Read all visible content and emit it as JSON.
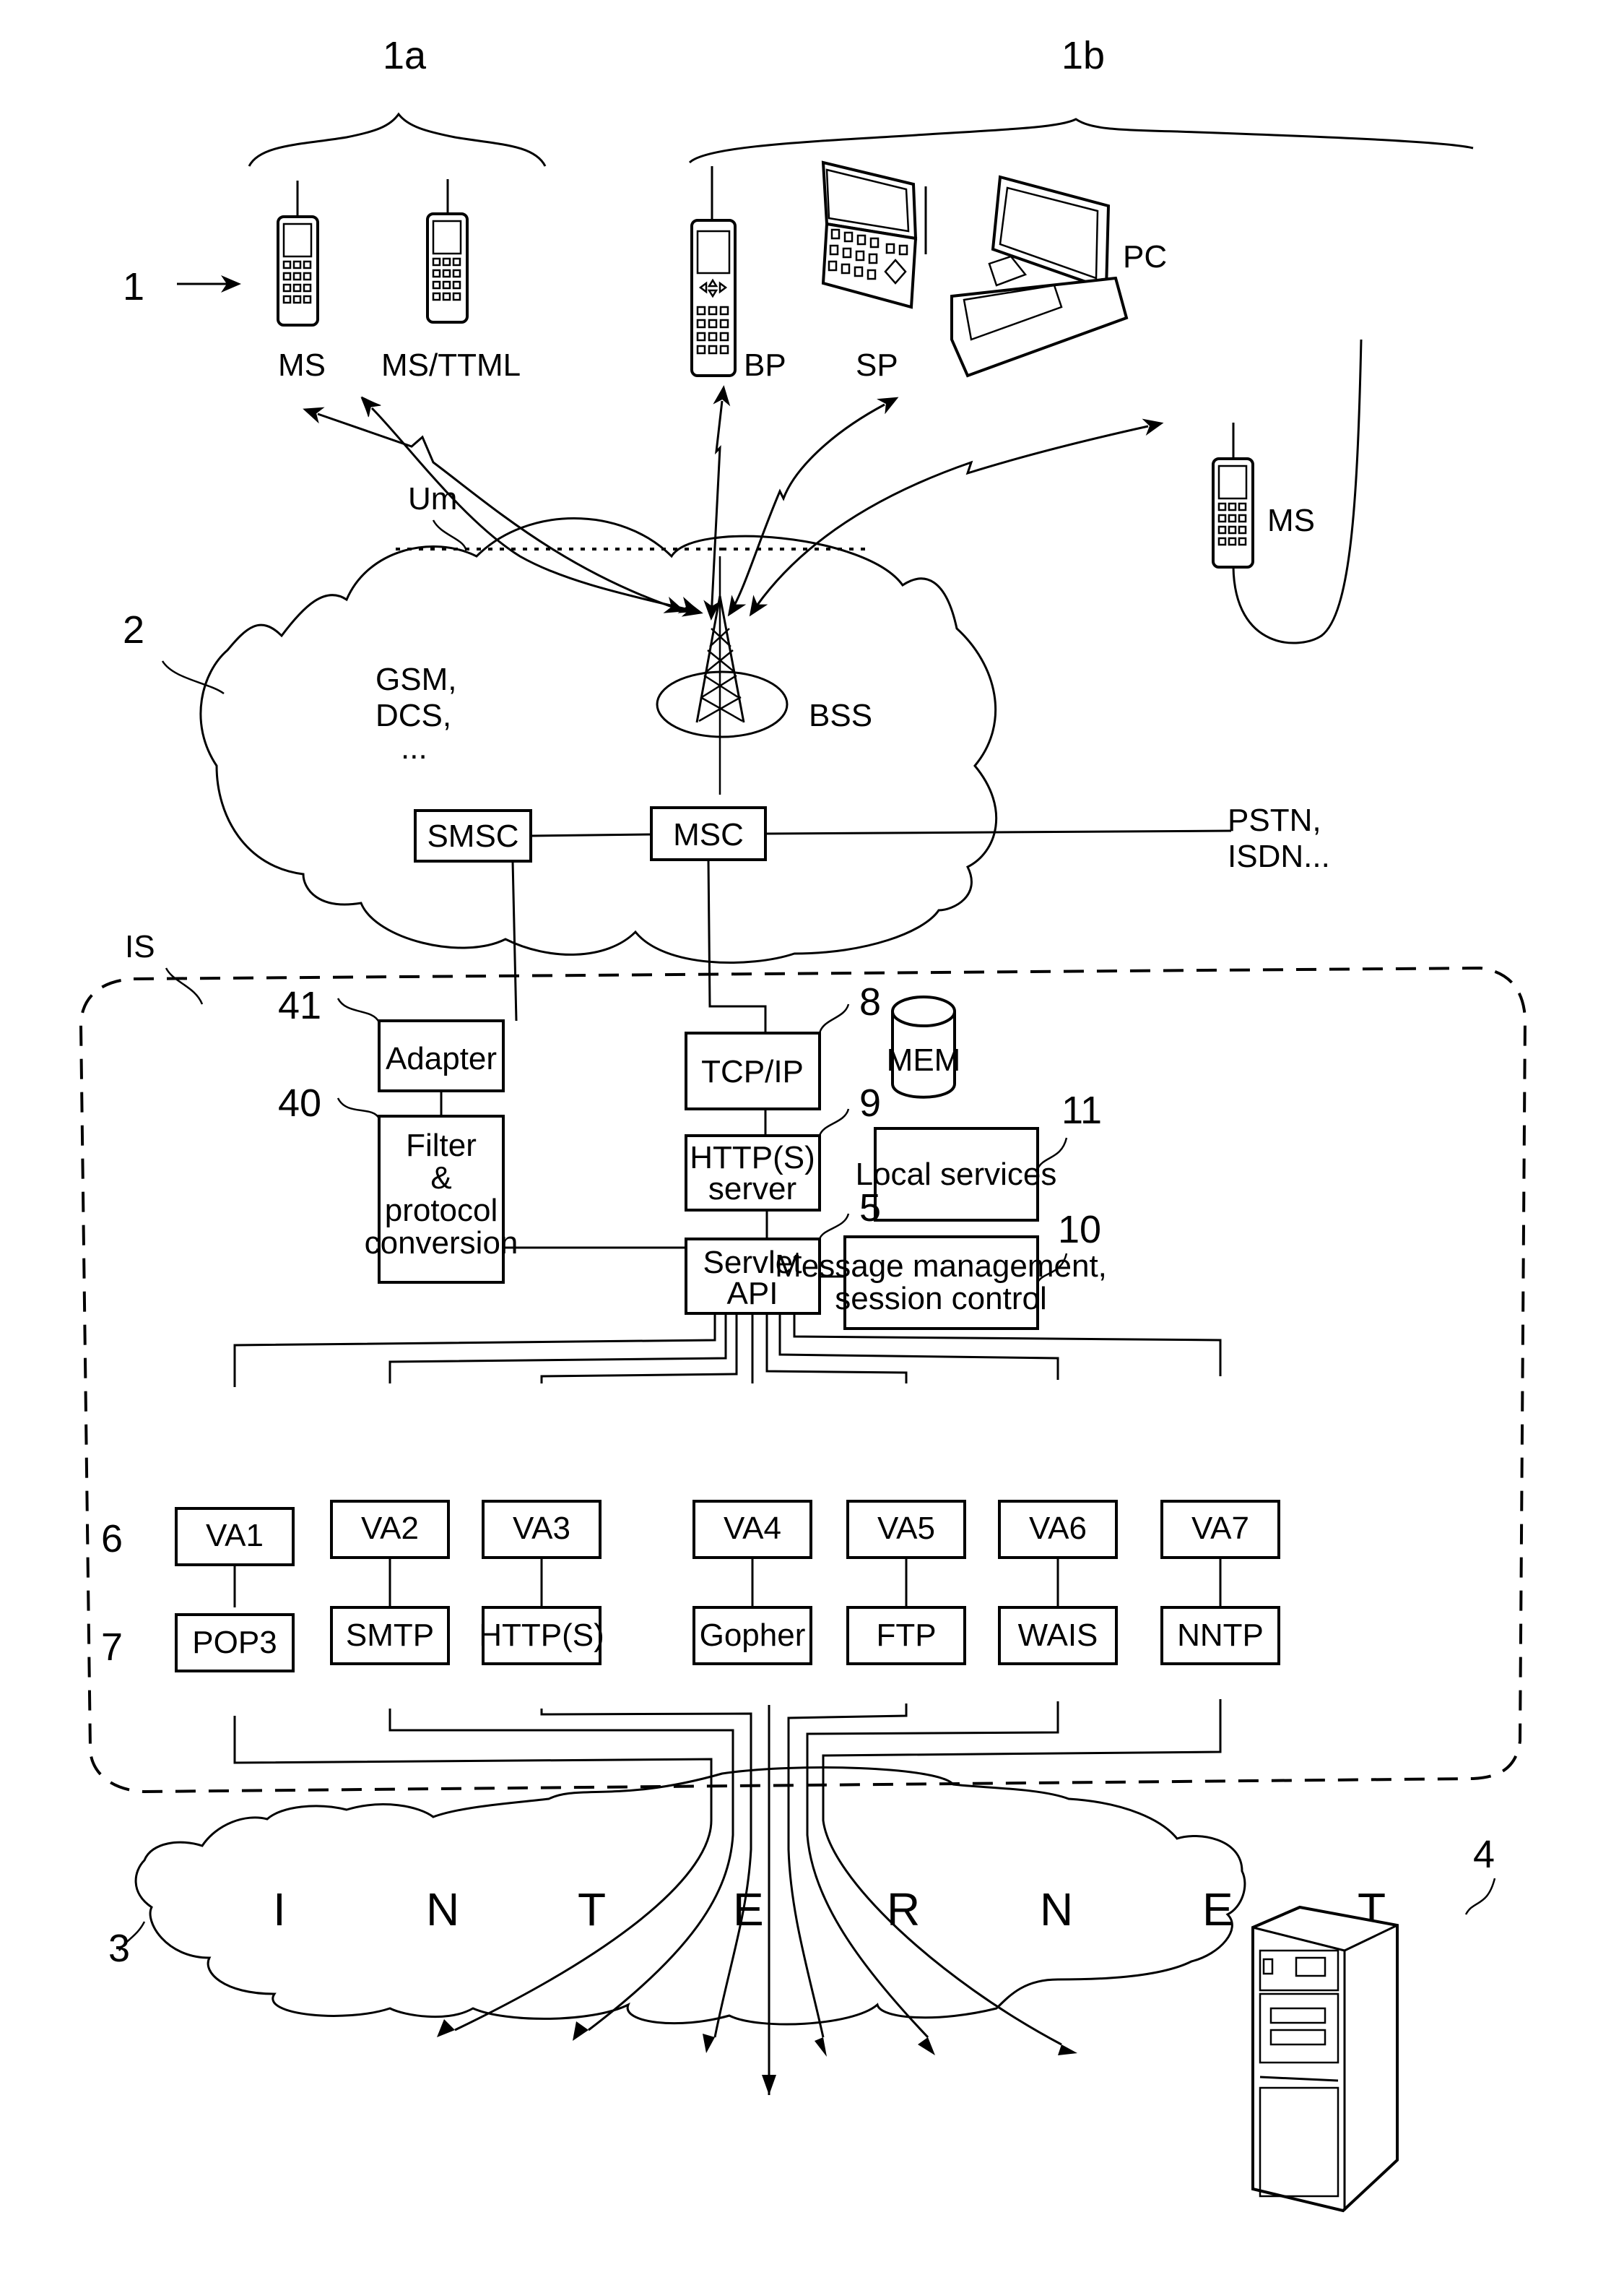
{
  "figure": {
    "ref_terminals": "1",
    "group_1a": "1a",
    "group_1b": "1b",
    "ref_mobile_network": "2",
    "ref_internet": "3",
    "ref_server": "4",
    "ref_servlet": "5",
    "ref_value_added": "6",
    "ref_protocols": "7",
    "ref_tcpip": "8",
    "ref_http_server": "9",
    "ref_message_mgmt": "10",
    "ref_local_services": "11",
    "ref_filter": "40",
    "ref_adapter": "41",
    "ref_is": "IS"
  },
  "terminals": {
    "ms": "MS",
    "ms_ttml": "MS/TTML",
    "bp": "BP",
    "sp": "SP",
    "pc": "PC",
    "ms_pc": "MS"
  },
  "air_interface": "Um",
  "mobile_network": {
    "types_line1": "GSM,",
    "types_line2": "DCS,",
    "types_line3": "...",
    "bss": "BSS",
    "smsc": "SMSC",
    "msc": "MSC",
    "external_line1": "PSTN,",
    "external_line2": "ISDN..."
  },
  "server": {
    "adapter": "Adapter",
    "tcpip": "TCP/IP",
    "mem": "MEM",
    "filter_line1": "Filter",
    "filter_line2": "&",
    "filter_line3": "protocol",
    "filter_line4": "conversion",
    "http_line1": "HTTP(S)",
    "http_line2": "server",
    "local_services": "Local services",
    "servlet_line1": "Servlet",
    "servlet_line2": "API",
    "msg_line1": "Message management,",
    "msg_line2": "session control"
  },
  "value_added": [
    "VA1",
    "VA2",
    "VA3",
    "VA4",
    "VA5",
    "VA6",
    "VA7"
  ],
  "protocols": [
    "POP3",
    "SMTP",
    "HTTP(S)",
    "Gopher",
    "FTP",
    "WAIS",
    "NNTP"
  ],
  "internet_letters": [
    "I",
    "N",
    "T",
    "E",
    "R",
    "N",
    "E",
    "T"
  ]
}
